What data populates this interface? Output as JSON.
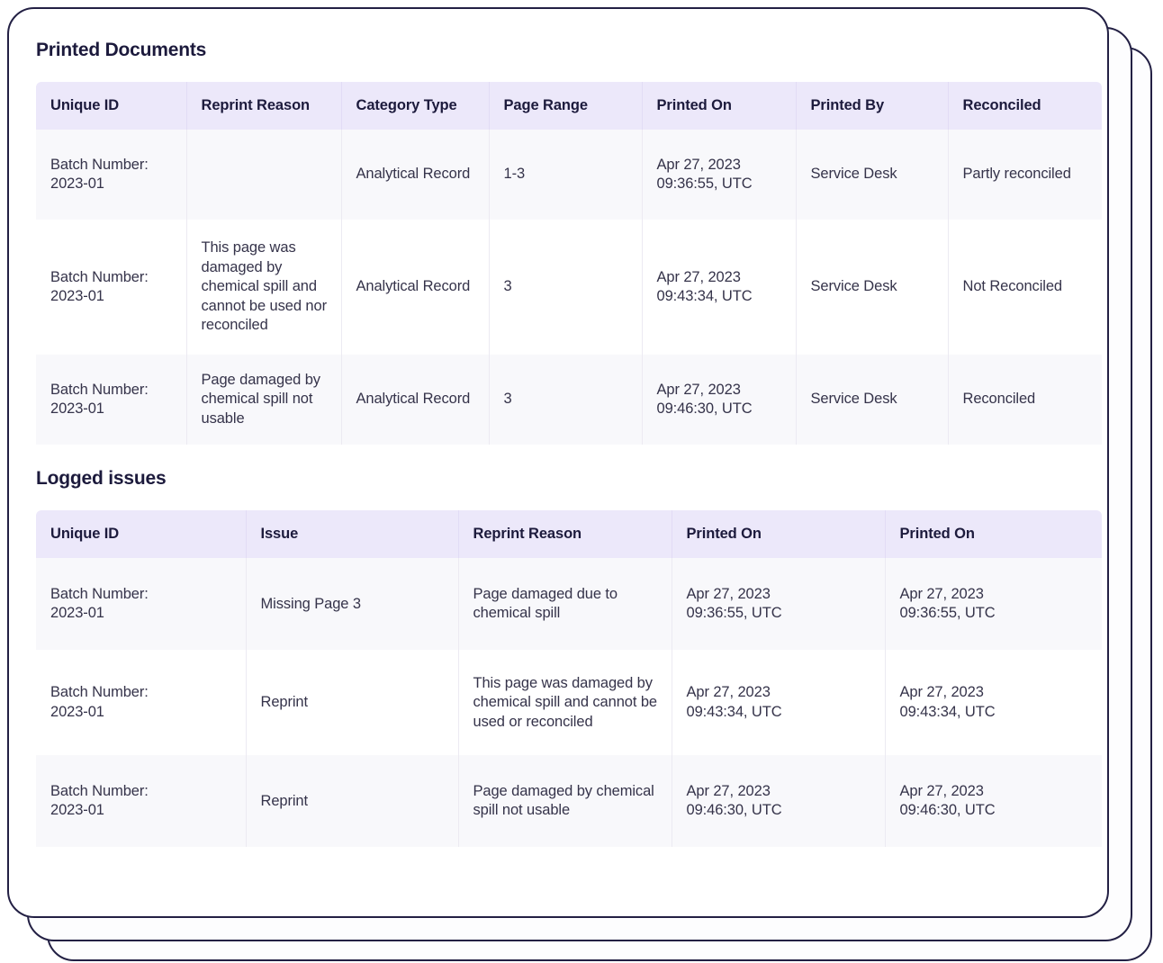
{
  "sections": [
    {
      "title": "Printed Documents",
      "table": {
        "columns": [
          "Unique ID",
          "Category  Type",
          "Reprint Reason",
          "Page Range",
          "Printed On",
          "Printed By",
          "Reconciled"
        ],
        "headers": {
          "unique_id": "Unique ID",
          "reprint_reason": "Reprint Reason",
          "category_type": "Category  Type",
          "page_range": "Page Range",
          "printed_on": "Printed On",
          "printed_by": "Printed By",
          "reconciled": "Reconciled"
        },
        "rows": [
          {
            "unique_id_label": "Batch Number:",
            "unique_id_value": "2023-01",
            "reprint_reason": "",
            "category_type": "Analytical Record",
            "page_range": "1-3",
            "printed_on_date": "Apr 27, 2023",
            "printed_on_time": "09:36:55, UTC",
            "printed_by": "Service Desk",
            "reconciled": "Partly reconciled"
          },
          {
            "unique_id_label": "Batch Number:",
            "unique_id_value": "2023-01",
            "reprint_reason": "This page was damaged by chemical spill and cannot be used nor reconciled",
            "category_type": "Analytical Record",
            "page_range": "3",
            "printed_on_date": "Apr 27, 2023",
            "printed_on_time": "09:43:34, UTC",
            "printed_by": "Service Desk",
            "reconciled": "Not Reconciled"
          },
          {
            "unique_id_label": "Batch Number:",
            "unique_id_value": "2023-01",
            "reprint_reason": "Page damaged by chemical spill not usable",
            "category_type": "Analytical Record",
            "page_range": "3",
            "printed_on_date": "Apr 27, 2023",
            "printed_on_time": "09:46:30, UTC",
            "printed_by": "Service Desk",
            "reconciled": "Reconciled"
          }
        ]
      }
    },
    {
      "title": "Logged issues",
      "table": {
        "columns": [
          "Unique ID",
          "Issue",
          "Reprint Reason",
          "Printed On",
          "Printed On"
        ],
        "headers": {
          "unique_id": "Unique ID",
          "issue": "Issue",
          "reprint_reason": "Reprint Reason",
          "printed_on_1": "Printed On",
          "printed_on_2": "Printed On"
        },
        "rows": [
          {
            "unique_id_label": "Batch Number:",
            "unique_id_value": "2023-01",
            "issue": "Missing Page 3",
            "reprint_reason": "Page damaged due to chemical spill",
            "printed_on_1_date": "Apr 27, 2023",
            "printed_on_1_time": "09:36:55, UTC",
            "printed_on_2_date": "Apr 27, 2023",
            "printed_on_2_time": "09:36:55, UTC"
          },
          {
            "unique_id_label": "Batch Number:",
            "unique_id_value": "2023-01",
            "issue": "Reprint",
            "reprint_reason": "This page was damaged by chemical spill and cannot be used or reconciled",
            "printed_on_1_date": "Apr 27, 2023",
            "printed_on_1_time": "09:43:34, UTC",
            "printed_on_2_date": "Apr 27, 2023",
            "printed_on_2_time": "09:43:34, UTC"
          },
          {
            "unique_id_label": "Batch Number:",
            "unique_id_value": "2023-01",
            "issue": "Reprint",
            "reprint_reason": "Page damaged by chemical spill not usable",
            "printed_on_1_date": "Apr 27, 2023",
            "printed_on_1_time": "09:46:30, UTC",
            "printed_on_2_date": "Apr 27, 2023",
            "printed_on_2_time": "09:46:30, UTC"
          }
        ]
      }
    }
  ],
  "colors": {
    "table_header_bg": "#ece8fa",
    "row_stripe_bg": "#f8f8fb",
    "card_border": "#232044",
    "heading_text": "#1c1a3c",
    "body_text": "#35334a"
  }
}
